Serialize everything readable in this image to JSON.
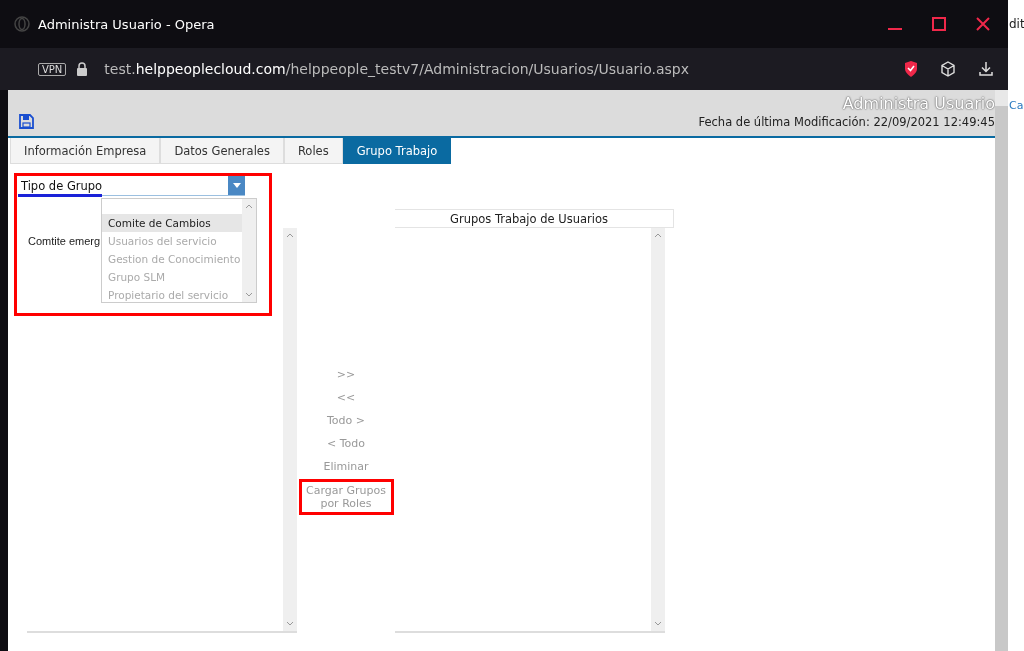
{
  "window": {
    "title": "Administra Usuario - Opera"
  },
  "address_bar": {
    "vpn_label": "VPN",
    "url": "test.**helppeoplecloud.com**/helppeople_testv7/Administracion/Usuarios/Usuario.aspx"
  },
  "background_window": {
    "text_top": "dit",
    "text_side": "Ca"
  },
  "header": {
    "title": "Administra Usuario",
    "modified": "Fecha de última Modificación: 22/09/2021 12:49:45"
  },
  "tabs": [
    {
      "label": "Información Empresa",
      "selected": false
    },
    {
      "label": "Datos Generales",
      "selected": false
    },
    {
      "label": "Roles",
      "selected": false
    },
    {
      "label": "Grupo Trabajo",
      "selected": true
    }
  ],
  "type_selector": {
    "value": "Tipo de Grupo",
    "underlined": true,
    "highlighted": true,
    "expanded": true,
    "options": [
      {
        "label": "Comite de Cambios",
        "selected": true
      },
      {
        "label": "Usuarios del servicio",
        "selected": false
      },
      {
        "label": "Gestion de Conocimiento",
        "selected": false
      },
      {
        "label": "Grupo SLM",
        "selected": false
      },
      {
        "label": "Propietario del servicio",
        "selected": false
      }
    ]
  },
  "available_list": {
    "items": [
      "Comtite emerg"
    ]
  },
  "actions": [
    {
      "label": ">>",
      "disabled": true,
      "highlighted": false
    },
    {
      "label": "<<",
      "disabled": true,
      "highlighted": false
    },
    {
      "label": "Todo >",
      "disabled": true,
      "highlighted": false
    },
    {
      "label": "< Todo",
      "disabled": true,
      "highlighted": false
    },
    {
      "label": "Eliminar",
      "disabled": true,
      "highlighted": false
    },
    {
      "label": "Cargar Grupos por Roles",
      "disabled": true,
      "highlighted": true
    }
  ],
  "assigned_list": {
    "title": "Grupos Trabajo de Usuarios"
  }
}
